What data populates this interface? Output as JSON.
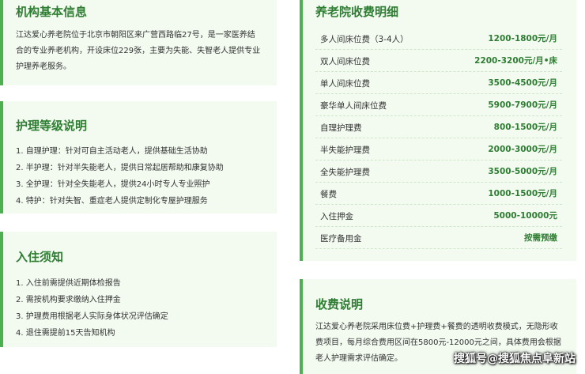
{
  "basic_info": {
    "title": "机构基本信息",
    "lines": [
      "江达爱心养老院位于北京市朝阳区来广营西路临27号，是一家医养结",
      "合的专业养老机构，开设床位229张，主要为失能、失智老人提供专业",
      "护理养老服务。"
    ]
  },
  "care_levels": {
    "title": "护理等级说明",
    "items": [
      "1. 自理护理：针对可自主活动老人，提供基础生活协助",
      "2. 半护理：针对半失能老人，提供日常起居帮助和康复协助",
      "3. 全护理：针对全失能老人，提供24小时专人专业照护",
      "4. 特护：针对失智、重症老人提供定制化专屋护理服务"
    ]
  },
  "admission": {
    "title": "入住须知",
    "items": [
      "1. 入住前需提供近期体检报告",
      "2. 需按机构要求缴纳入住押金",
      "3. 护理费用根据老人实际身体状况评估确定",
      "4. 退住需提前15天告知机构"
    ]
  },
  "fees": {
    "title": "养老院收费明细",
    "rows": [
      {
        "label": "多人间床位费（3-4人）",
        "value": "1200-1800元/月"
      },
      {
        "label": "双人间床位费",
        "value": "2200-3200元/月•床"
      },
      {
        "label": "单人间床位费",
        "value": "3500-4500元/月"
      },
      {
        "label": "豪华单人间床位费",
        "value": "5900-7900元/月"
      },
      {
        "label": "自理护理费",
        "value": "800-1500元/月"
      },
      {
        "label": "半失能护理费",
        "value": "2000-3000元/月"
      },
      {
        "label": "全失能护理费",
        "value": "3500-5000元/月"
      },
      {
        "label": "餐费",
        "value": "1000-1500元/月"
      },
      {
        "label": "入住押金",
        "value": "5000-10000元"
      },
      {
        "label": "医疗备用金",
        "value": "按需预缴"
      }
    ]
  },
  "fee_notes": {
    "title": "收费说明",
    "lines": [
      "江达爱心养老院采用床位费+护理费+餐费的透明收费模式，无隐形收",
      "费项目，每月综合费用区间在5800元-12000元之间，具体费用会根据",
      "老人护理需求评估确定。"
    ]
  },
  "watermark": "搜狐号@搜狐焦点阜新站"
}
